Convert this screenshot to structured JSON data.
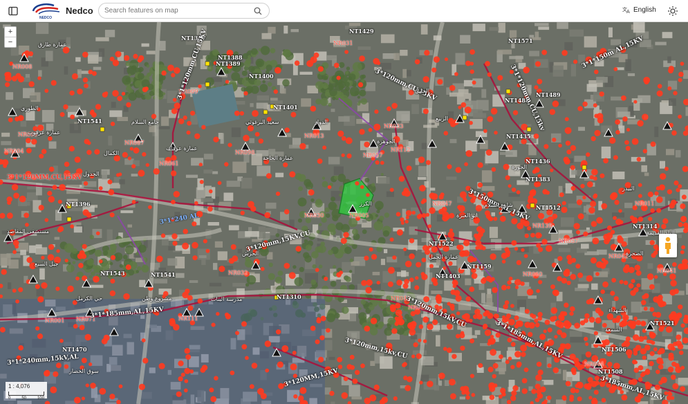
{
  "header": {
    "app_title": "Nedco",
    "logo_text": "NEDCO",
    "search_placeholder": "Search features on map",
    "language_label": "English"
  },
  "colors": {
    "accent_marker": "#ff3b1f",
    "cable_line": "#a8123c",
    "transformer_label": "#ffffff",
    "substation_fill": "#2ecc40"
  },
  "icons": {
    "sidebar": "sidebar-icon",
    "search": "search-icon",
    "language": "translate-icon",
    "theme": "sun-icon",
    "pegman": "street-view-icon"
  },
  "map": {
    "zoom_in": "+",
    "zoom_out": "−",
    "scale_ratio": "1 : 4,076",
    "scale_ticks": [
      "0",
      "50",
      "100"
    ],
    "transformer_labels": [
      "NT1387",
      "NT1388",
      "NT1389",
      "NT1400",
      "NT1401",
      "NT1429",
      "NT1571",
      "NT1488",
      "NT1489",
      "NT1435",
      "NT1436",
      "NT1383",
      "NT1512",
      "NT1396",
      "NT1541",
      "NT1310",
      "NT1159",
      "NT1521",
      "NT1541",
      "NT1506",
      "NT1508",
      "NT1470",
      "NT1543",
      "NT1522",
      "NT1314",
      "NT1403"
    ],
    "network_labels": [
      "NR008",
      "NR009",
      "NR069",
      "NR204",
      "NR087",
      "NR061",
      "NR098",
      "NR013",
      "NR031",
      "NR033",
      "NR057",
      "NR112",
      "NR047",
      "NR139",
      "NR042",
      "NR043",
      "NR060",
      "NR057",
      "NR030",
      "NR011",
      "NR005",
      "NR015",
      "NR041",
      "NR044",
      "NR001",
      "NR071",
      "NR111",
      "NR032"
    ],
    "cable_labels": [
      "3*1*120mm,CU,15KV",
      "3*120mm,CU,15KV",
      "3*1*120mm,CU,15kv",
      "3*1*150m AL,15KV",
      "3*120mm,15KV,CU",
      "3*120mm,15kv,CU",
      "3*120mm,15kV,CU",
      "3*1*185mm,AL,15KV",
      "3*185mm,AL,15KV",
      "3*1*240mm,15kV,AL",
      "3*150mm,AL,15KV",
      "3*1*120MM,CU,15KV",
      "3*1*240 AL",
      "3*120MM,15KV",
      "3*1*185mm,AL,15KV"
    ],
    "place_labels": [
      "عمارة طارق",
      "الطوري",
      "عمارة عرقوب",
      "الكمال",
      "جامع السلام",
      "مستشفى المقاصد",
      "الجدول",
      "عمارة الحاجة",
      "سعيد البرغوثي",
      "الدوار",
      "الكرز",
      "الجوهرة",
      "الخليل",
      "الربيع",
      "الجورة",
      "ابو العنزة",
      "الصحرة",
      "البلد القديمة",
      "حي الكرمل",
      "جبل السبع",
      "الحرش",
      "مدرسة البنات",
      "عمارة عرفات",
      "شارع السلام",
      "البيدر",
      "عمارة الجمل",
      "الشهداء",
      "السمعة",
      "مشروع وطن",
      "سوق الخضار"
    ]
  }
}
